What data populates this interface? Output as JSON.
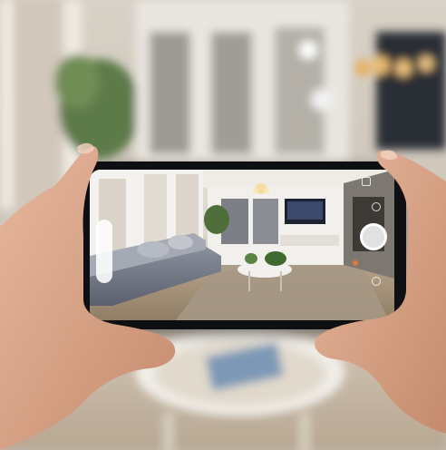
{
  "camera_ui": {
    "mode_labels": [
      "",
      "",
      ""
    ]
  },
  "icons": {
    "shutter": "shutter-button-icon",
    "flash": "flash-icon",
    "switch": "camera-switch-icon",
    "settings": "settings-icon"
  },
  "colors": {
    "accent": "#e07a3c"
  }
}
